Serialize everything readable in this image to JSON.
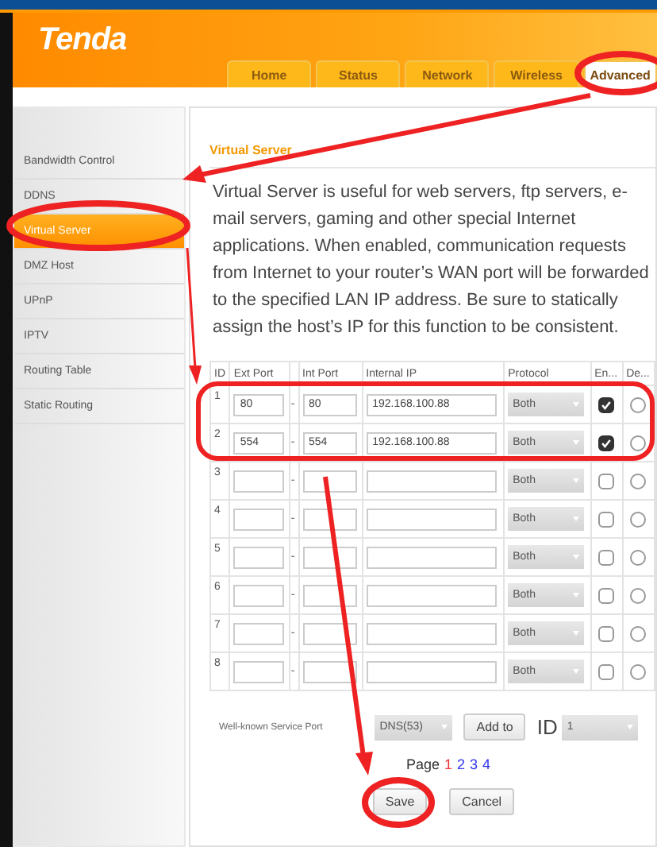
{
  "header": {
    "logo": "Tenda",
    "tabs": [
      {
        "label": "Home",
        "selected": false
      },
      {
        "label": "Status",
        "selected": false
      },
      {
        "label": "Network",
        "selected": false
      },
      {
        "label": "Wireless",
        "selected": false
      },
      {
        "label": "Advanced",
        "selected": true
      }
    ]
  },
  "sidebar": {
    "items": [
      {
        "label": "Bandwidth Control",
        "selected": false
      },
      {
        "label": "DDNS",
        "selected": false
      },
      {
        "label": "Virtual Server",
        "selected": true
      },
      {
        "label": "DMZ Host",
        "selected": false
      },
      {
        "label": "UPnP",
        "selected": false
      },
      {
        "label": "IPTV",
        "selected": false
      },
      {
        "label": "Routing Table",
        "selected": false
      },
      {
        "label": "Static Routing",
        "selected": false
      }
    ]
  },
  "content": {
    "title": "Virtual Server",
    "description": "Virtual Server is useful for web servers, ftp servers, e-mail servers, gaming and other special Internet applications. When enabled, communication requests from Internet to your router’s WAN port will be forwarded to the specified LAN IP address. Be sure to statically assign the host’s IP for this function to be consistent.",
    "table": {
      "columns": [
        "ID",
        "Ext Port",
        "Int Port",
        "Internal IP",
        "Protocol",
        "En...",
        "De..."
      ],
      "range_separator": "-",
      "rows": [
        {
          "id": "1",
          "ext_port": "80",
          "int_port": "80",
          "internal_ip": "192.168.100.88",
          "protocol": "Both",
          "enabled": true,
          "delete": false
        },
        {
          "id": "2",
          "ext_port": "554",
          "int_port": "554",
          "internal_ip": "192.168.100.88",
          "protocol": "Both",
          "enabled": true,
          "delete": false
        },
        {
          "id": "3",
          "protocol": "Both",
          "enabled": false,
          "delete": false
        },
        {
          "id": "4",
          "protocol": "Both",
          "enabled": false,
          "delete": false
        },
        {
          "id": "5",
          "protocol": "Both",
          "enabled": false,
          "delete": false
        },
        {
          "id": "6",
          "protocol": "Both",
          "enabled": false,
          "delete": false
        },
        {
          "id": "7",
          "protocol": "Both",
          "enabled": false,
          "delete": false
        },
        {
          "id": "8",
          "protocol": "Both",
          "enabled": false,
          "delete": false
        }
      ]
    },
    "well_known": {
      "label": "Well-known Service Port",
      "service": "DNS(53)",
      "add_button": "Add to",
      "id_label": "ID",
      "id_value": "1"
    },
    "pagination": {
      "label": "Page",
      "pages": [
        {
          "label": "1",
          "selected": true
        },
        {
          "label": "2",
          "selected": false
        },
        {
          "label": "3",
          "selected": false
        },
        {
          "label": "4",
          "selected": false
        }
      ]
    },
    "buttons": [
      "Save",
      "Cancel"
    ]
  }
}
